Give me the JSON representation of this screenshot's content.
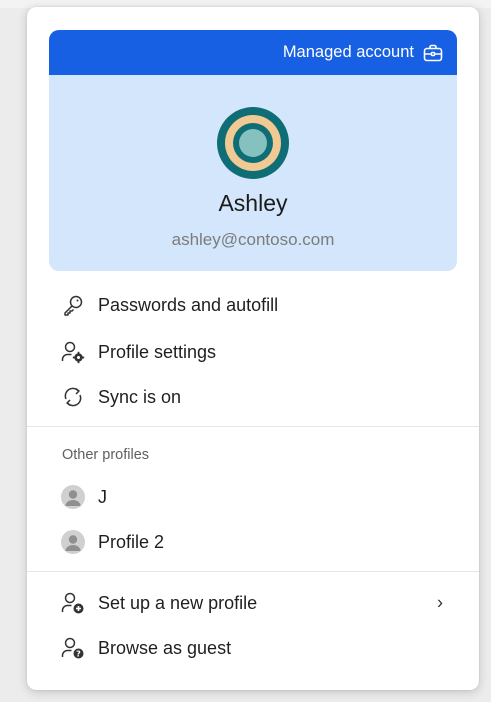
{
  "profile": {
    "managed_label": "Managed account",
    "name": "Ashley",
    "email": "ashley@contoso.com"
  },
  "menu": [
    {
      "label": "Passwords and autofill",
      "icon": "key-icon"
    },
    {
      "label": "Profile settings",
      "icon": "person-gear-icon"
    },
    {
      "label": "Sync is on",
      "icon": "sync-icon"
    }
  ],
  "other_profiles": {
    "heading": "Other profiles",
    "items": [
      {
        "label": "J",
        "icon": "person-avatar-icon"
      },
      {
        "label": "Profile 2",
        "icon": "person-avatar-icon"
      }
    ]
  },
  "actions": [
    {
      "label": "Set up a new profile",
      "icon": "person-add-icon",
      "chevron": "›"
    },
    {
      "label": "Browse as guest",
      "icon": "guest-icon"
    }
  ],
  "colors": {
    "banner": "#1760e4",
    "card": "#d3e6fb",
    "avatar_rings": [
      "#0f6e75",
      "#f0c993",
      "#84c1bf"
    ]
  }
}
